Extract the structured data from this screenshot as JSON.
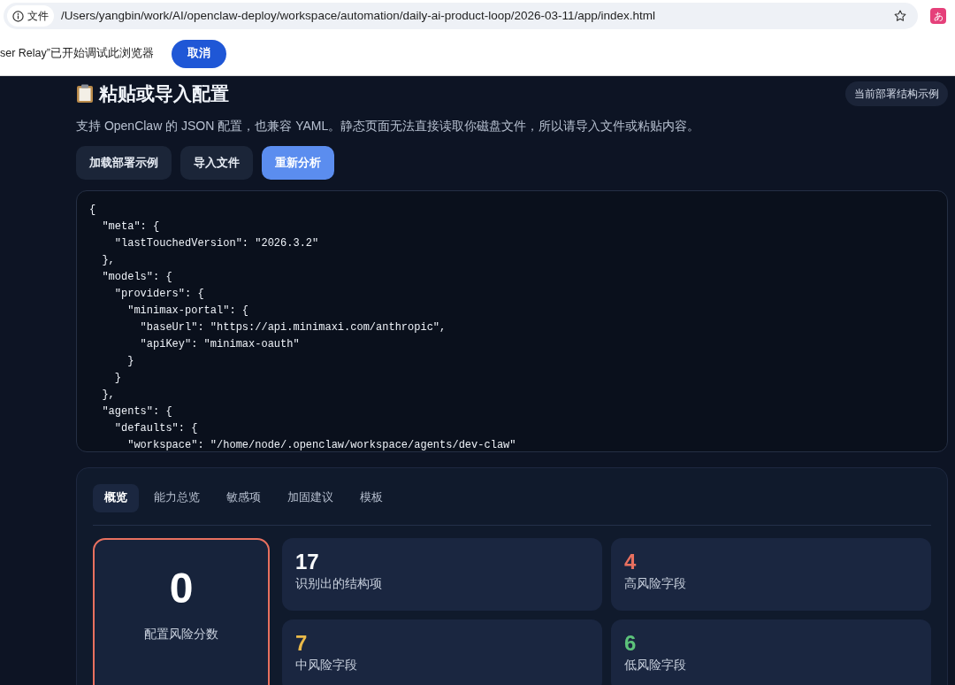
{
  "browser": {
    "site_label": "文件",
    "url": "/Users/yangbin/work/AI/openclaw-deploy/workspace/automation/daily-ai-product-loop/2026-03-11/app/index.html",
    "extension_label": "あ"
  },
  "infobar": {
    "message": "ser Relay”已开始调试此浏览器",
    "button": "取消"
  },
  "header": {
    "title": "粘贴或导入配置",
    "badge": "当前部署结构示例",
    "description": "支持 OpenClaw 的 JSON 配置，也兼容 YAML。静态页面无法直接读取你磁盘文件，所以请导入文件或粘贴内容。"
  },
  "actions": [
    {
      "label": "加载部署示例",
      "kind": "secondary"
    },
    {
      "label": "导入文件",
      "kind": "secondary"
    },
    {
      "label": "重新分析",
      "kind": "primary"
    }
  ],
  "editor": {
    "lines": [
      "{",
      "  \"meta\": {",
      "    \"lastTouchedVersion\": \"2026.3.2\"",
      "  },",
      "  \"models\": {",
      "    \"providers\": {",
      "      \"minimax-portal\": {",
      "        \"baseUrl\": \"https://api.minimaxi.com/anthropic\",",
      "        \"apiKey\": \"minimax-oauth\"",
      "      }",
      "    }",
      "  },",
      "  \"agents\": {",
      "    \"defaults\": {",
      "      \"workspace\": \"/home/node/.openclaw/workspace/agents/dev-claw\""
    ]
  },
  "tabs": [
    {
      "label": "概览",
      "selected": true
    },
    {
      "label": "能力总览",
      "selected": false
    },
    {
      "label": "敏感项",
      "selected": false
    },
    {
      "label": "加固建议",
      "selected": false
    },
    {
      "label": "模板",
      "selected": false
    }
  ],
  "score": {
    "value": "0",
    "label": "配置风险分数"
  },
  "stats": [
    {
      "value": "17",
      "label": "识别出的结构项",
      "color": "#f8fafc"
    },
    {
      "value": "4",
      "label": "高风险字段",
      "color": "#e8705f"
    },
    {
      "value": "7",
      "label": "中风险字段",
      "color": "#e9b949"
    },
    {
      "value": "6",
      "label": "低风险字段",
      "color": "#5cc27a"
    }
  ]
}
